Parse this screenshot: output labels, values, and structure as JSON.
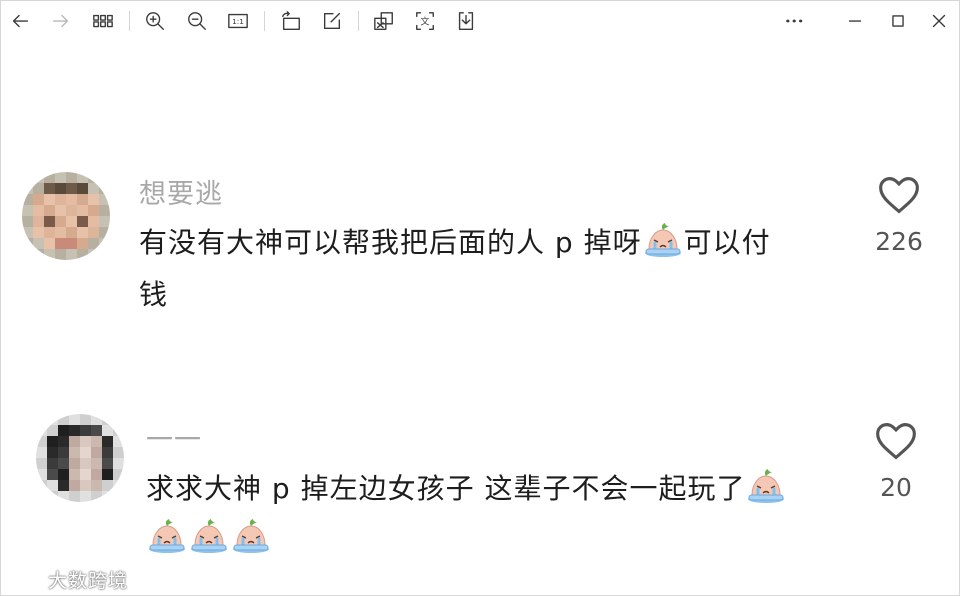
{
  "toolbar": {
    "icons": [
      "back-arrow-icon",
      "forward-arrow-icon",
      "grid-view-icon",
      "zoom-in-icon",
      "zoom-out-icon",
      "actual-size-icon",
      "rotate-icon",
      "edit-icon",
      "extract-text-icon",
      "translate-icon",
      "save-icon",
      "more-icon",
      "minimize-icon",
      "maximize-icon",
      "close-icon"
    ],
    "actual_size_label": "1:1",
    "translate_label": "文"
  },
  "comments": [
    {
      "username": "想要逃",
      "text_line1": "有没有大神可以帮我把后面的人 p 掉呀",
      "text_line1_after_emoji": "可以付",
      "text_line2": "钱",
      "likes": "226"
    },
    {
      "username": "一一",
      "text_line1": "求求大神 p 掉左边女孩子 这辈子不会一起玩了",
      "likes": "20"
    }
  ],
  "watermark": "大数跨境",
  "colors": {
    "username": "#a8a8a8",
    "text": "#1d1d1d",
    "icon": "#3a3a3a",
    "like": "#555555"
  }
}
